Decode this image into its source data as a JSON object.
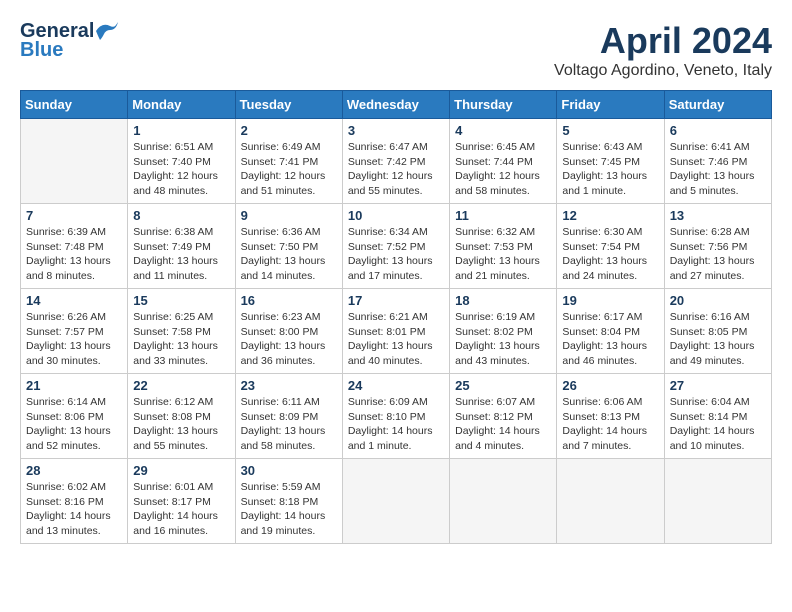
{
  "header": {
    "logo_line1": "General",
    "logo_line2": "Blue",
    "month": "April 2024",
    "location": "Voltago Agordino, Veneto, Italy"
  },
  "weekdays": [
    "Sunday",
    "Monday",
    "Tuesday",
    "Wednesday",
    "Thursday",
    "Friday",
    "Saturday"
  ],
  "weeks": [
    [
      {
        "day": null
      },
      {
        "day": 1,
        "sunrise": "6:51 AM",
        "sunset": "7:40 PM",
        "daylight": "12 hours and 48 minutes."
      },
      {
        "day": 2,
        "sunrise": "6:49 AM",
        "sunset": "7:41 PM",
        "daylight": "12 hours and 51 minutes."
      },
      {
        "day": 3,
        "sunrise": "6:47 AM",
        "sunset": "7:42 PM",
        "daylight": "12 hours and 55 minutes."
      },
      {
        "day": 4,
        "sunrise": "6:45 AM",
        "sunset": "7:44 PM",
        "daylight": "12 hours and 58 minutes."
      },
      {
        "day": 5,
        "sunrise": "6:43 AM",
        "sunset": "7:45 PM",
        "daylight": "13 hours and 1 minute."
      },
      {
        "day": 6,
        "sunrise": "6:41 AM",
        "sunset": "7:46 PM",
        "daylight": "13 hours and 5 minutes."
      }
    ],
    [
      {
        "day": 7,
        "sunrise": "6:39 AM",
        "sunset": "7:48 PM",
        "daylight": "13 hours and 8 minutes."
      },
      {
        "day": 8,
        "sunrise": "6:38 AM",
        "sunset": "7:49 PM",
        "daylight": "13 hours and 11 minutes."
      },
      {
        "day": 9,
        "sunrise": "6:36 AM",
        "sunset": "7:50 PM",
        "daylight": "13 hours and 14 minutes."
      },
      {
        "day": 10,
        "sunrise": "6:34 AM",
        "sunset": "7:52 PM",
        "daylight": "13 hours and 17 minutes."
      },
      {
        "day": 11,
        "sunrise": "6:32 AM",
        "sunset": "7:53 PM",
        "daylight": "13 hours and 21 minutes."
      },
      {
        "day": 12,
        "sunrise": "6:30 AM",
        "sunset": "7:54 PM",
        "daylight": "13 hours and 24 minutes."
      },
      {
        "day": 13,
        "sunrise": "6:28 AM",
        "sunset": "7:56 PM",
        "daylight": "13 hours and 27 minutes."
      }
    ],
    [
      {
        "day": 14,
        "sunrise": "6:26 AM",
        "sunset": "7:57 PM",
        "daylight": "13 hours and 30 minutes."
      },
      {
        "day": 15,
        "sunrise": "6:25 AM",
        "sunset": "7:58 PM",
        "daylight": "13 hours and 33 minutes."
      },
      {
        "day": 16,
        "sunrise": "6:23 AM",
        "sunset": "8:00 PM",
        "daylight": "13 hours and 36 minutes."
      },
      {
        "day": 17,
        "sunrise": "6:21 AM",
        "sunset": "8:01 PM",
        "daylight": "13 hours and 40 minutes."
      },
      {
        "day": 18,
        "sunrise": "6:19 AM",
        "sunset": "8:02 PM",
        "daylight": "13 hours and 43 minutes."
      },
      {
        "day": 19,
        "sunrise": "6:17 AM",
        "sunset": "8:04 PM",
        "daylight": "13 hours and 46 minutes."
      },
      {
        "day": 20,
        "sunrise": "6:16 AM",
        "sunset": "8:05 PM",
        "daylight": "13 hours and 49 minutes."
      }
    ],
    [
      {
        "day": 21,
        "sunrise": "6:14 AM",
        "sunset": "8:06 PM",
        "daylight": "13 hours and 52 minutes."
      },
      {
        "day": 22,
        "sunrise": "6:12 AM",
        "sunset": "8:08 PM",
        "daylight": "13 hours and 55 minutes."
      },
      {
        "day": 23,
        "sunrise": "6:11 AM",
        "sunset": "8:09 PM",
        "daylight": "13 hours and 58 minutes."
      },
      {
        "day": 24,
        "sunrise": "6:09 AM",
        "sunset": "8:10 PM",
        "daylight": "14 hours and 1 minute."
      },
      {
        "day": 25,
        "sunrise": "6:07 AM",
        "sunset": "8:12 PM",
        "daylight": "14 hours and 4 minutes."
      },
      {
        "day": 26,
        "sunrise": "6:06 AM",
        "sunset": "8:13 PM",
        "daylight": "14 hours and 7 minutes."
      },
      {
        "day": 27,
        "sunrise": "6:04 AM",
        "sunset": "8:14 PM",
        "daylight": "14 hours and 10 minutes."
      }
    ],
    [
      {
        "day": 28,
        "sunrise": "6:02 AM",
        "sunset": "8:16 PM",
        "daylight": "14 hours and 13 minutes."
      },
      {
        "day": 29,
        "sunrise": "6:01 AM",
        "sunset": "8:17 PM",
        "daylight": "14 hours and 16 minutes."
      },
      {
        "day": 30,
        "sunrise": "5:59 AM",
        "sunset": "8:18 PM",
        "daylight": "14 hours and 19 minutes."
      },
      {
        "day": null
      },
      {
        "day": null
      },
      {
        "day": null
      },
      {
        "day": null
      }
    ]
  ]
}
